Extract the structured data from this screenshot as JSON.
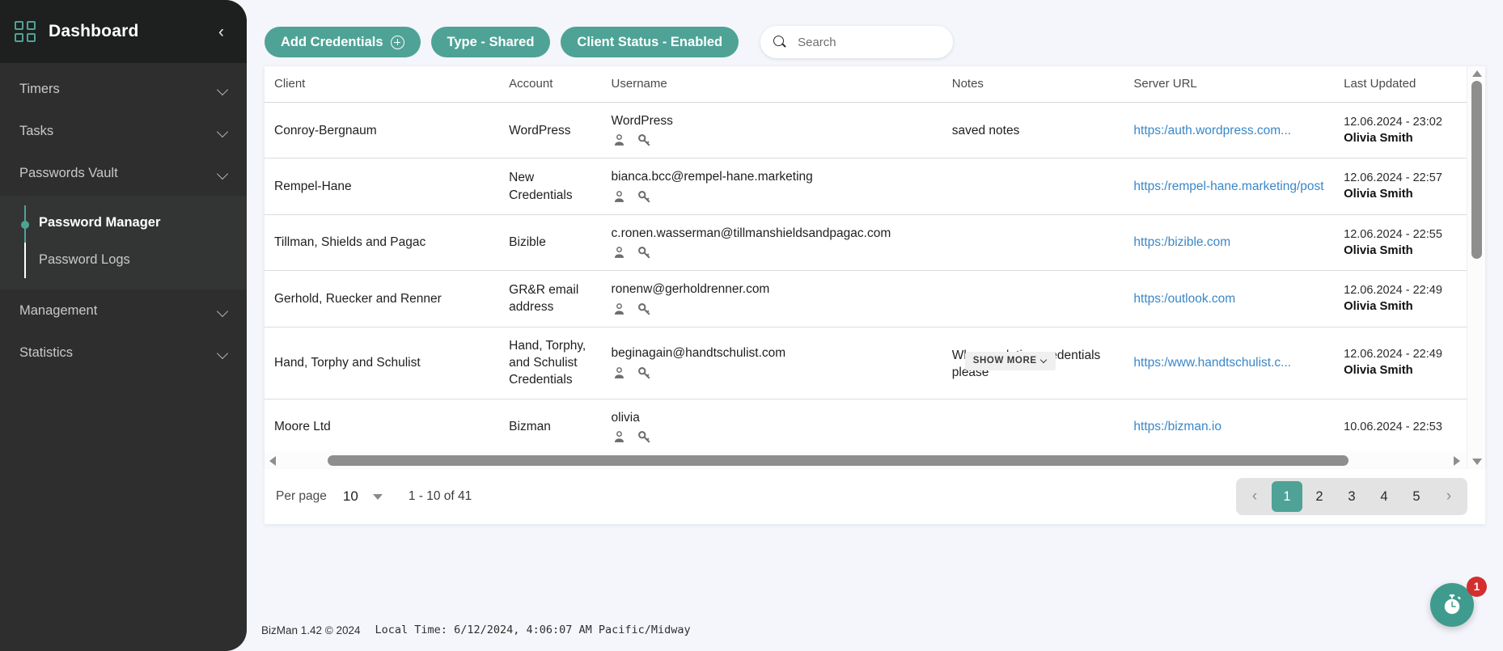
{
  "sidebar": {
    "logo_icon": "grid-icon",
    "title": "Dashboard",
    "collapse_icon": "chevron-left-icon",
    "items": [
      {
        "label": "Timers",
        "icon": "chevron-down-icon"
      },
      {
        "label": "Tasks",
        "icon": "chevron-down-icon"
      },
      {
        "label": "Passwords Vault",
        "icon": "chevron-down-icon"
      }
    ],
    "sub_items": [
      {
        "label": "Password Manager",
        "active": true
      },
      {
        "label": "Password Logs",
        "active": false
      }
    ],
    "items_after": [
      {
        "label": "Management",
        "icon": "chevron-down-icon"
      },
      {
        "label": "Statistics",
        "icon": "chevron-down-icon"
      }
    ]
  },
  "toolbar": {
    "add_credentials_label": "Add Credentials",
    "add_icon": "plus-circle-icon",
    "type_filter_label": "Type - Shared",
    "client_status_filter_label": "Client Status - Enabled",
    "search_placeholder": "Search",
    "search_value": "",
    "search_icon": "search-icon"
  },
  "table": {
    "columns": [
      "Client",
      "Account",
      "Username",
      "Notes",
      "Server URL",
      "Last Updated"
    ],
    "rows": [
      {
        "client": "Conroy-Bergnaum",
        "account": "WordPress",
        "username": "WordPress",
        "notes": "saved notes",
        "notes_truncated": false,
        "url": "https:/auth.wordpress.com...",
        "updated_date": "12.06.2024 - 23:02",
        "updated_by": "Olivia Smith"
      },
      {
        "client": "Rempel-Hane",
        "account": "New Credentials",
        "username": "bianca.bcc@rempel-hane.marketing",
        "notes": "",
        "notes_truncated": false,
        "url": "https:/rempel-hane.marketing/post",
        "updated_date": "12.06.2024 - 22:57",
        "updated_by": "Olivia Smith"
      },
      {
        "client": "Tillman, Shields and Pagac",
        "account": "Bizible",
        "username": "c.ronen.wasserman@tillmanshieldsandpagac.com",
        "notes": "",
        "notes_truncated": false,
        "url": "https:/bizible.com",
        "updated_date": "12.06.2024 - 22:55",
        "updated_by": "Olivia Smith"
      },
      {
        "client": "Gerhold, Ruecker and Renner",
        "account": "GR&R email address",
        "username": "ronenw@gerholdrenner.com",
        "notes": "",
        "notes_truncated": false,
        "url": "https:/outlook.com",
        "updated_date": "12.06.2024 - 22:49",
        "updated_by": "Olivia Smith"
      },
      {
        "client": "Hand, Torphy and Schulist",
        "account": "Hand, Torphy, and Schulist Credentials",
        "username": "beginagain@handtschulist.com",
        "notes": "When updating credentials please",
        "notes_truncated": true,
        "show_more_label": "SHOW MORE",
        "url": "https:/www.handtschulist.c...",
        "updated_date": "12.06.2024 - 22:49",
        "updated_by": "Olivia Smith"
      },
      {
        "client": "Moore Ltd",
        "account": "Bizman",
        "username": "olivia",
        "notes": "",
        "notes_truncated": false,
        "url": "https:/bizman.io",
        "updated_date": "10.06.2024 - 22:53",
        "updated_by": ""
      }
    ],
    "row_icons": [
      "person-icon",
      "key-icon"
    ]
  },
  "pagination": {
    "per_page_label": "Per page",
    "per_page_value": "10",
    "range_label": "1 - 10 of 41",
    "prev_icon": "chevron-left-icon",
    "next_icon": "chevron-right-icon",
    "pages": [
      "1",
      "2",
      "3",
      "4",
      "5"
    ],
    "active_page": "1"
  },
  "footer": {
    "brand": "BizMan 1.42 © 2024",
    "local_time": "Local Time: 6/12/2024, 4:06:07 AM Pacific/Midway"
  },
  "fab": {
    "icon": "stopwatch-icon",
    "badge_count": "1"
  },
  "colors": {
    "accent_teal": "#4ea396",
    "sidebar_bg": "#2e2e2e",
    "sidebar_header_bg": "#1e1f1f",
    "link_blue": "#3a87c8",
    "badge_red": "#d32f2f",
    "page_bg": "#f4f6fb"
  }
}
